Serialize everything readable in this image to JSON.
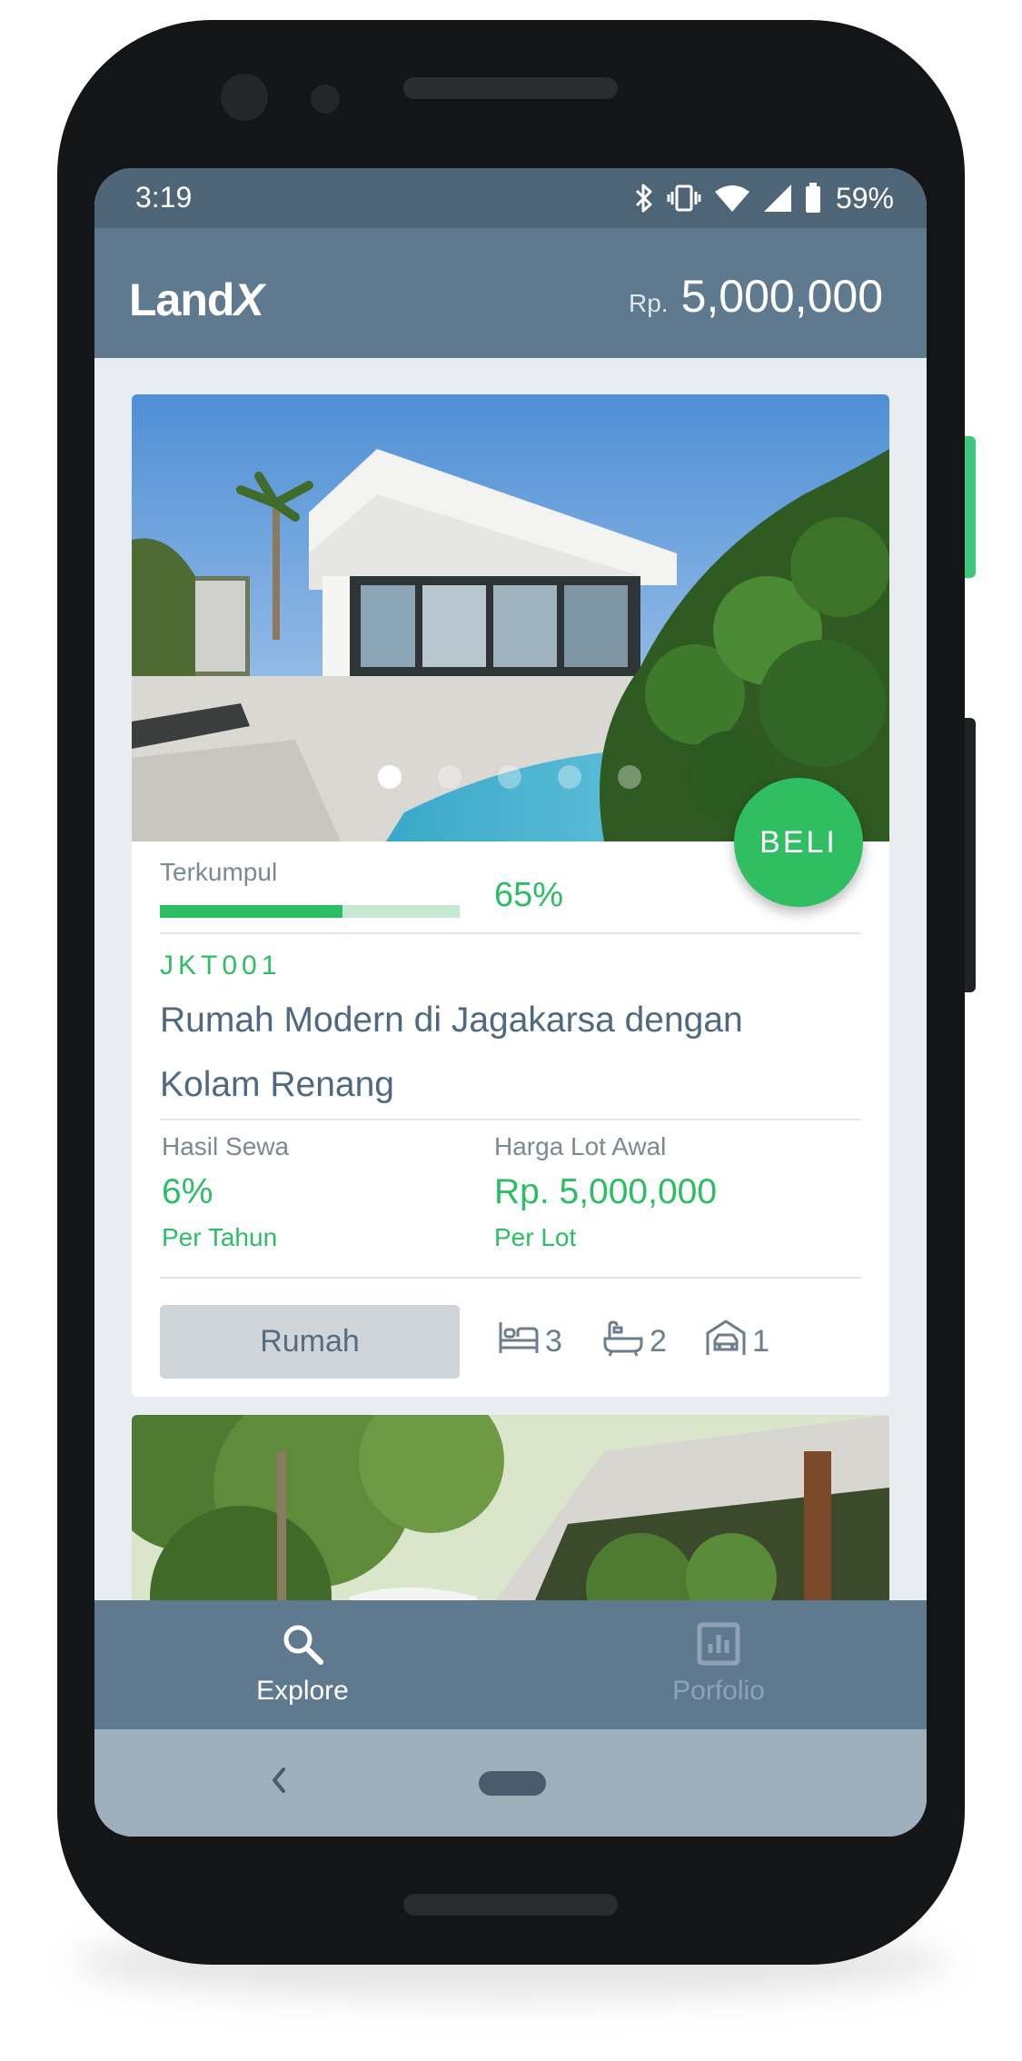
{
  "status_bar": {
    "time": "3:19",
    "battery_percent": "59%",
    "icons": [
      "bluetooth-icon",
      "vibrate-icon",
      "wifi-icon",
      "signal-icon",
      "battery-icon"
    ]
  },
  "header": {
    "logo_main": "Land",
    "logo_x": "X",
    "balance_prefix": "Rp.",
    "balance_amount": "5,000,000"
  },
  "listings": [
    {
      "progress_label": "Terkumpul",
      "progress_percent": "65%",
      "progress_value": 0.61,
      "buy_label": "BELI",
      "code": "JKT001",
      "title": "Rumah Modern di Jagakarsa dengan Kolam Renang",
      "rent_label": "Hasil Sewa",
      "rent_value": "6%",
      "rent_period": "Per Tahun",
      "price_label": "Harga Lot Awal",
      "price_value": "Rp. 5,000,000",
      "price_unit": "Per Lot",
      "type": "Rumah",
      "bedrooms": "3",
      "bathrooms": "2",
      "garage": "1",
      "carousel_dots": 5,
      "carousel_active": 0
    }
  ],
  "bottom_nav": {
    "items": [
      {
        "label": "Explore",
        "icon": "search-icon",
        "active": true
      },
      {
        "label": "Porfolio",
        "icon": "chart-icon",
        "active": false
      }
    ]
  },
  "colors": {
    "accent_green": "#2cbe62",
    "app_bar": "#5f7a8f",
    "status_bar": "#4e6577",
    "title_text": "#4f6a80"
  }
}
